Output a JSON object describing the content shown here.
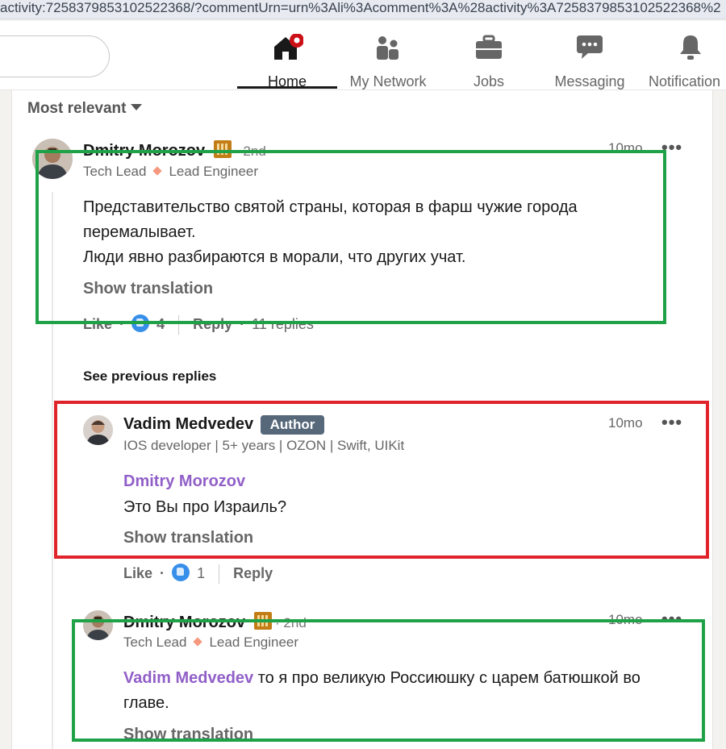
{
  "browser": {
    "url": "activity:7258379853102522368/?commentUrn=urn%3Ali%3Acomment%3A%28activity%3A7258379853102522368%2"
  },
  "nav": {
    "items": [
      {
        "label": "Home",
        "icon": "home-icon",
        "active": true,
        "badge": true
      },
      {
        "label": "My Network",
        "icon": "network-icon"
      },
      {
        "label": "Jobs",
        "icon": "briefcase-icon"
      },
      {
        "label": "Messaging",
        "icon": "messaging-icon"
      },
      {
        "label": "Notification",
        "icon": "bell-icon"
      }
    ]
  },
  "sort": {
    "label": "Most relevant"
  },
  "comments": [
    {
      "author": "Dmitry Morozov",
      "degree": "· 2nd",
      "headline_1": "Tech Lead",
      "headline_2": "Lead Engineer",
      "time": "10mo",
      "text_line_1": "Представительство святой страны, которая в фарш чужие города",
      "text_line_2": "перемалывает.",
      "text_line_3": "Люди явно разбираются в морали, что других учат.",
      "translation": "Show translation",
      "like": "Like",
      "reaction_count": "4",
      "reply": "Reply",
      "replies": "11 replies"
    }
  ],
  "see_previous": "See previous replies",
  "replies": [
    {
      "author": "Vadim Medvedev",
      "badge": "Author",
      "headline": "IOS developer | 5+ years | OZON | Swift, UIKit",
      "time": "10mo",
      "mention": "Dmitry Morozov",
      "text": "Это Вы про Израиль?",
      "translation": "Show translation",
      "like": "Like",
      "reaction_count": "1",
      "reply": "Reply"
    },
    {
      "author": "Dmitry Morozov",
      "degree": "· 2nd",
      "headline_1": "Tech Lead",
      "headline_2": "Lead Engineer",
      "time": "10mo",
      "mention": "Vadim Medvedev",
      "text_line_1": " то я про великую Россиюшку с царем батюшкой во",
      "text_line_2": "главе.",
      "translation": "Show translation"
    }
  ],
  "colors": {
    "highlight_green": "#1fa247",
    "highlight_red": "#e0232b",
    "mention": "#915fc8",
    "notification_badge": "#cc1016"
  }
}
